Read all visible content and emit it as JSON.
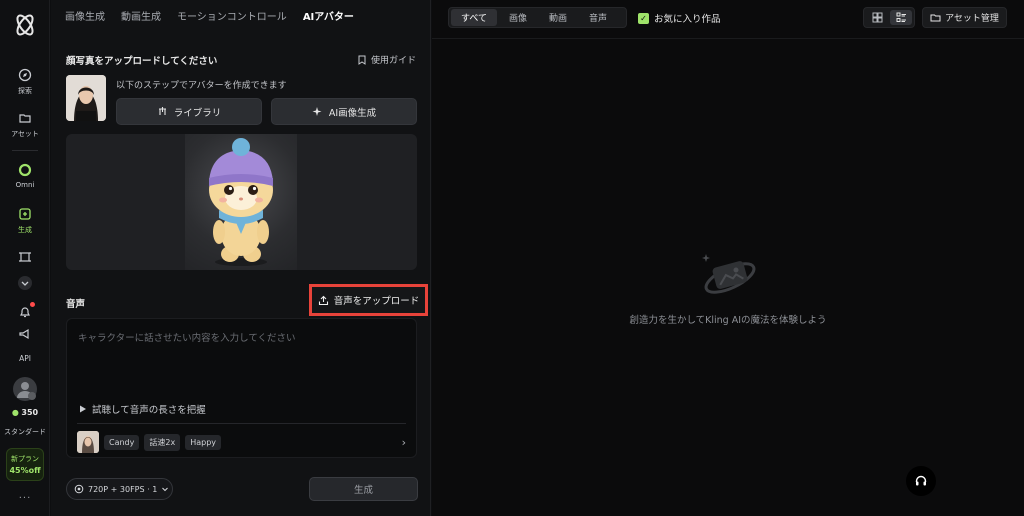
{
  "rail": {
    "items": [
      {
        "label": "探索"
      },
      {
        "label": "アセット"
      },
      {
        "label": "Omni"
      },
      {
        "label": "生成"
      },
      {
        "label": "API"
      },
      {
        "label": "スタンダード"
      }
    ],
    "credits": "350",
    "plan_tag": {
      "line1": "新プラン",
      "line2": "45%off"
    },
    "more": "..."
  },
  "panel": {
    "tabs": [
      "画像生成",
      "動画生成",
      "モーションコントロール",
      "AIアバター"
    ],
    "upload_title": "顔写真をアップロードしてください",
    "guide_label": "使用ガイド",
    "steps_text": "以下のステップでアバターを作成できます",
    "library_button": "ライブラリ",
    "ai_image_button": "AI画像生成",
    "audio_title": "音声",
    "upload_audio_button": "音声をアップロード",
    "text_placeholder": "キャラクターに話させたい内容を入力してください",
    "trial_label": "試聴して音声の長さを把握",
    "voice_chips": [
      "Candy",
      "話速2x",
      "Happy"
    ],
    "quality_label": "720P + 30FPS · 1",
    "generate_button": "生成"
  },
  "right": {
    "filters": [
      "すべて",
      "画像",
      "動画",
      "音声"
    ],
    "favorites_label": "お気に入り作品",
    "asset_button": "アセット管理",
    "empty_message": "創造力を生かしてKling AIの魔法を体験しよう"
  },
  "colors": {
    "accent": "#9fe36a",
    "highlight": "#e8433a"
  }
}
